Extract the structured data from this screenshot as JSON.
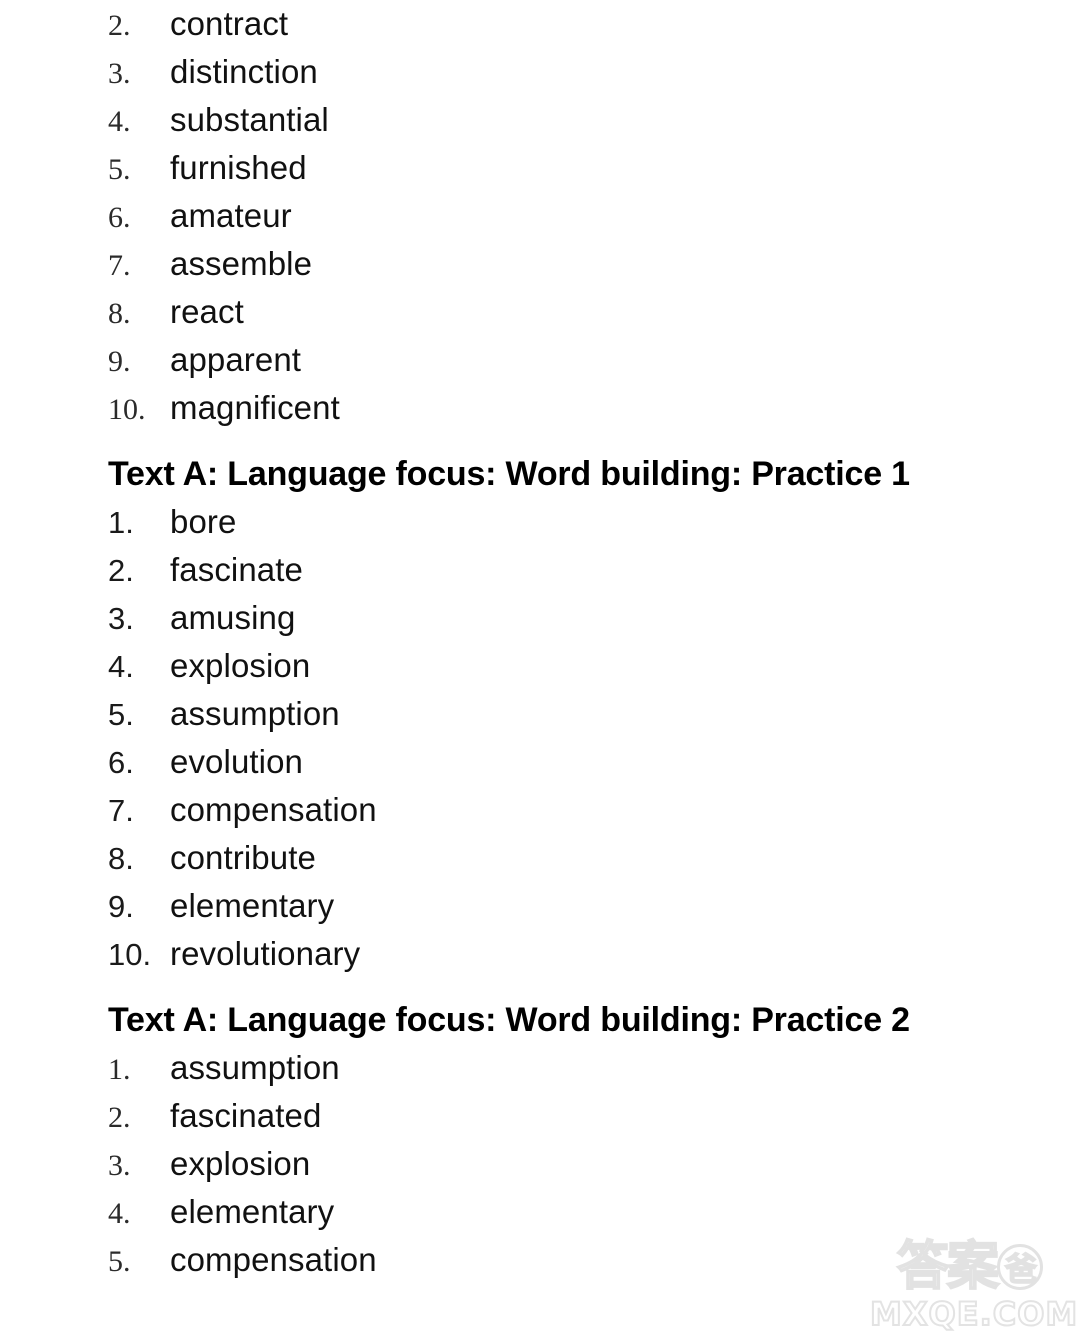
{
  "document": {
    "background_color": "#ffffff",
    "text_color": "#111111"
  },
  "list_one": {
    "items": [
      {
        "num": "2.",
        "word": "contract"
      },
      {
        "num": "3.",
        "word": "distinction"
      },
      {
        "num": "4.",
        "word": "substantial"
      },
      {
        "num": "5.",
        "word": "furnished"
      },
      {
        "num": "6.",
        "word": "amateur"
      },
      {
        "num": "7.",
        "word": "assemble"
      },
      {
        "num": "8.",
        "word": "react"
      },
      {
        "num": "9.",
        "word": "apparent"
      },
      {
        "num": "10.",
        "word": "magnificent"
      }
    ]
  },
  "heading_one": {
    "text": "Text A: Language focus: Word building: Practice 1"
  },
  "list_two": {
    "items": [
      {
        "num": "1.",
        "word": "bore"
      },
      {
        "num": "2.",
        "word": "fascinate"
      },
      {
        "num": "3.",
        "word": "amusing"
      },
      {
        "num": "4.",
        "word": "explosion"
      },
      {
        "num": "5.",
        "word": "assumption"
      },
      {
        "num": "6.",
        "word": "evolution"
      },
      {
        "num": "7.",
        "word": "compensation"
      },
      {
        "num": "8.",
        "word": "contribute"
      },
      {
        "num": "9.",
        "word": "elementary"
      },
      {
        "num": "10.",
        "word": "revolutionary"
      }
    ]
  },
  "heading_two": {
    "text": "Text A: Language focus: Word building: Practice 2"
  },
  "list_three": {
    "items": [
      {
        "num": "1.",
        "word": "assumption"
      },
      {
        "num": "2.",
        "word": "fascinated"
      },
      {
        "num": "3.",
        "word": "explosion"
      },
      {
        "num": "4.",
        "word": "elementary"
      },
      {
        "num": "5.",
        "word": "compensation"
      }
    ]
  },
  "watermark": {
    "cn_left": "答案",
    "cn_circle": "爸",
    "domain": "MXQE.COM",
    "color": "#e2e2e2"
  }
}
